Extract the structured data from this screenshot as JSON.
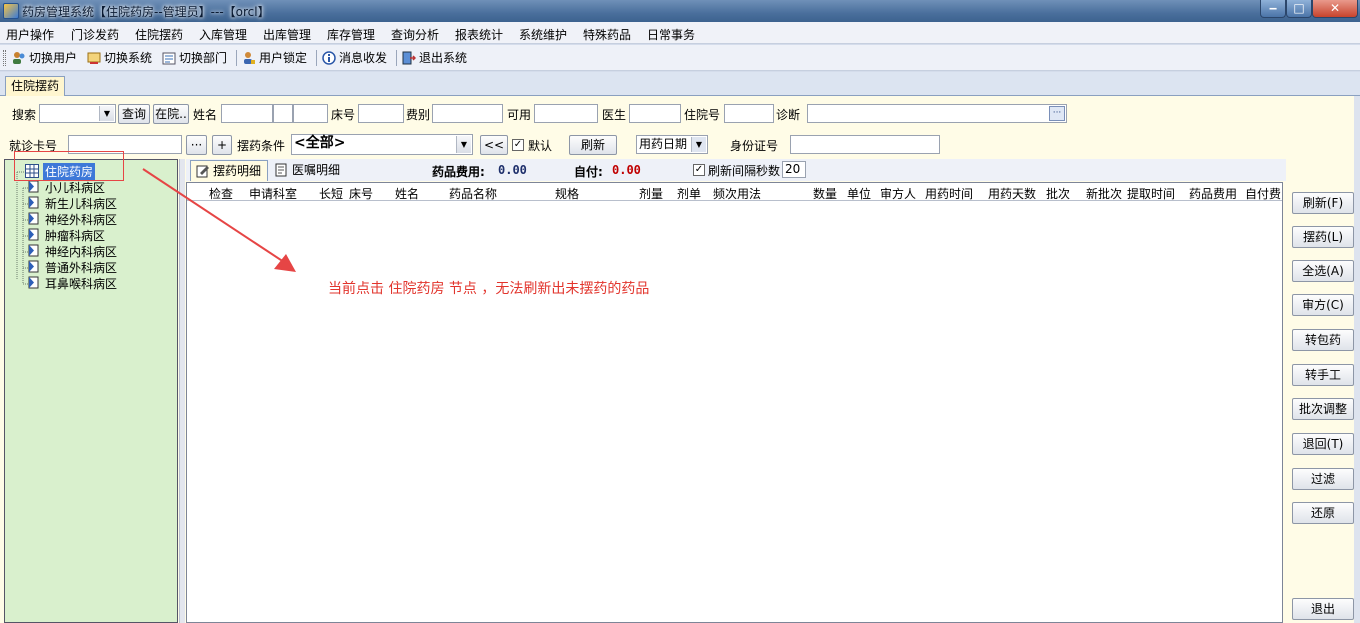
{
  "window": {
    "title": "药房管理系统【住院药房--管理员】---【orcl】"
  },
  "menu": [
    "用户操作",
    "门诊发药",
    "住院摆药",
    "入库管理",
    "出库管理",
    "库存管理",
    "查询分析",
    "报表统计",
    "系统维护",
    "特殊药品",
    "日常事务"
  ],
  "toolbar": {
    "switch_user": "切换用户",
    "switch_system": "切换系统",
    "switch_dept": "切换部门",
    "lock_user": "用户锁定",
    "messages": "消息收发",
    "exit_system": "退出系统"
  },
  "module_tab": "住院摆药",
  "search_row": {
    "search_label": "搜索",
    "query_btn": "查询",
    "inpatient_btn": "在院..",
    "name_label": "姓名",
    "bed_label": "床号",
    "fee_label": "费别",
    "available_label": "可用",
    "doctor_label": "医生",
    "inpatient_no_label": "住院号",
    "diagnosis_label": "诊断",
    "ellipsis": "···"
  },
  "filter_row": {
    "card_label": "就诊卡号",
    "ellipsis_btn": "···",
    "plus_btn": "+",
    "condition_label": "摆药条件",
    "condition_value": "<全部>",
    "back_btn": "<<",
    "default_label": "默认",
    "refresh_btn": "刷新",
    "date_value": "用药日期",
    "id_label": "身份证号"
  },
  "tree": {
    "root": "住院药房",
    "items": [
      "小儿科病区",
      "新生儿科病区",
      "神经外科病区",
      "肿瘤科病区",
      "神经内科病区",
      "普通外科病区",
      "耳鼻喉科病区"
    ]
  },
  "detail_tabs": {
    "dispense": "摆药明细",
    "orders": "医嘱明细"
  },
  "summary": {
    "drug_fee_label": "药品费用:",
    "drug_fee_value": "0.00",
    "self_pay_label": "自付:",
    "self_pay_value": "0.00",
    "refresh_interval_label": "刷新间隔秒数",
    "refresh_interval_value": "20"
  },
  "grid_columns": [
    "检查",
    "申请科室",
    "长短",
    "床号",
    "姓名",
    "药品名称",
    "规格",
    "剂量",
    "剂单",
    "频次用法",
    "数量",
    "单位",
    "审方人",
    "用药时间",
    "用药天数",
    "批次",
    "新批次",
    "提取时间",
    "药品费用",
    "自付费"
  ],
  "side_buttons": [
    "刷新(F)",
    "摆药(L)",
    "全选(A)",
    "审方(C)",
    "转包药",
    "转手工",
    "批次调整",
    "退回(T)",
    "过滤",
    "还原"
  ],
  "exit_btn": "退出",
  "annotation": "当前点击 住院药房 节点 ，无法刷新出未摆药的药品",
  "colors": {
    "accent_red": "#e2342c",
    "tree_bg": "#d9f0cd",
    "fee_value": "#c00000",
    "panel_bg": "#fffce7"
  }
}
